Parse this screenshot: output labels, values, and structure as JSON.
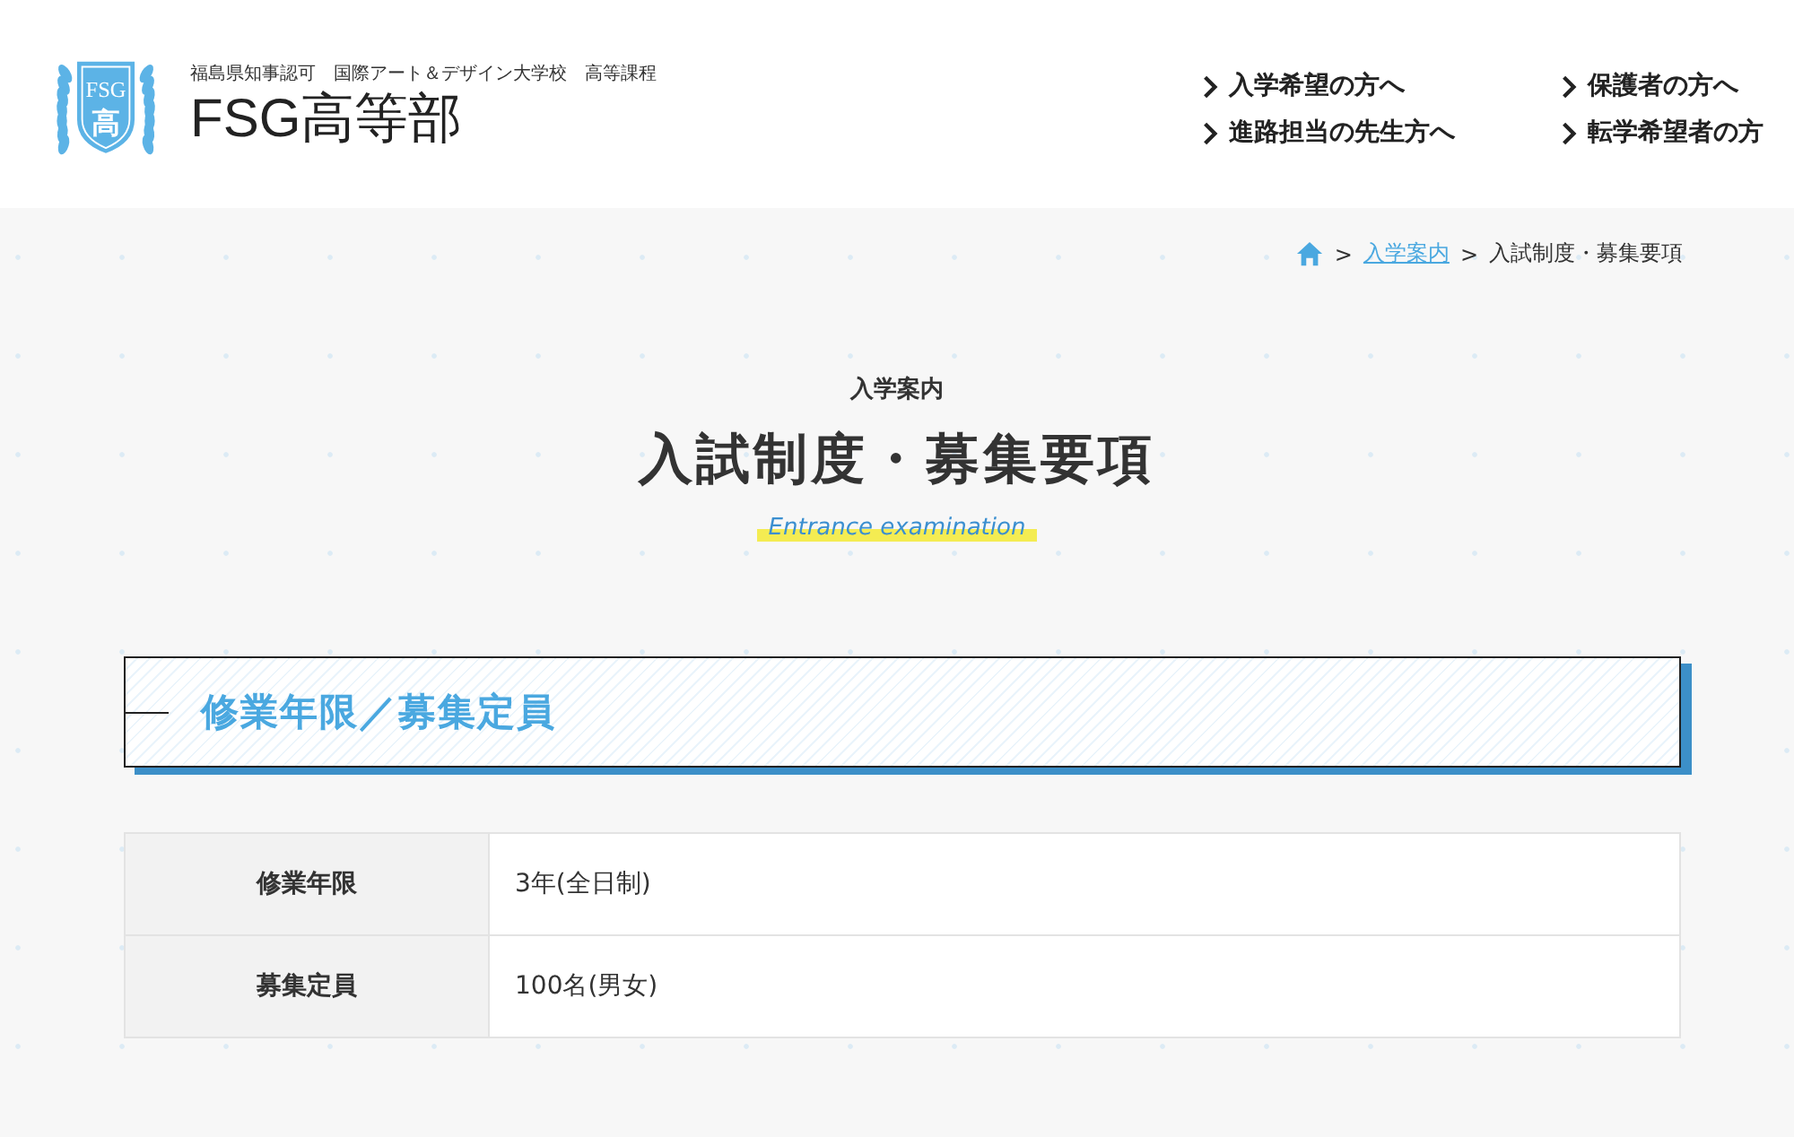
{
  "header": {
    "logo": {
      "mark_top": "FSG",
      "mark_bottom": "高"
    },
    "tagline": "福島県知事認可　国際アート＆デザイン大学校　高等課程",
    "site_name": "FSG高等部",
    "nav": [
      {
        "label": "入学希望の方へ"
      },
      {
        "label": "保護者の方へ"
      },
      {
        "label": "進路担当の先生方へ"
      },
      {
        "label": "転学希望者の方"
      }
    ]
  },
  "breadcrumb": {
    "separator": ">",
    "links": [
      {
        "label": "入学案内"
      }
    ],
    "current": "入試制度・募集要項"
  },
  "page_heading": {
    "category": "入学案内",
    "title": "入試制度・募集要項",
    "english": "Entrance examination"
  },
  "section": {
    "title": "修業年限／募集定員",
    "rows": [
      {
        "label": "修業年限",
        "value": "3年(全日制)"
      },
      {
        "label": "募集定員",
        "value": "100名(男女)"
      }
    ]
  }
}
